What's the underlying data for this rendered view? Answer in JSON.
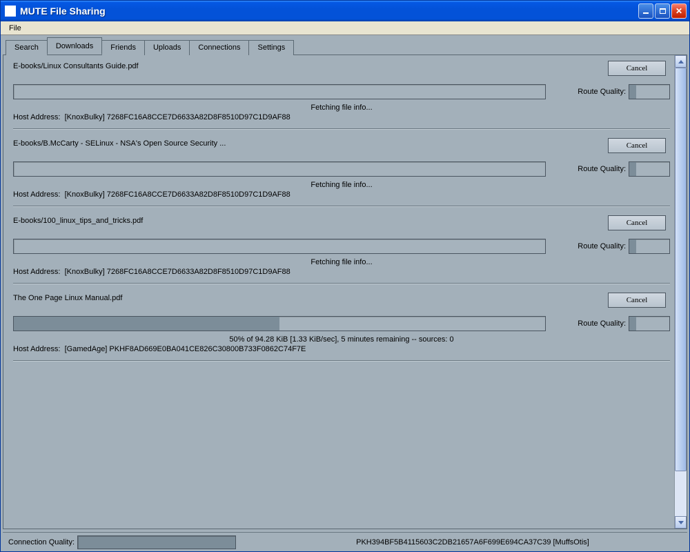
{
  "window": {
    "title": "MUTE File Sharing"
  },
  "menu": {
    "file": "File"
  },
  "tabs": {
    "search": "Search",
    "downloads": "Downloads",
    "friends": "Friends",
    "uploads": "Uploads",
    "connections": "Connections",
    "settings": "Settings"
  },
  "labels": {
    "cancel": "Cancel",
    "route_quality": "Route Quality:",
    "host_address": "Host Address:",
    "connection_quality": "Connection Quality:"
  },
  "downloads": [
    {
      "filename": "E-books/Linux Consultants Guide.pdf",
      "progress_percent": 0,
      "route_quality_percent": 18,
      "status": "Fetching file info...",
      "host": "[KnoxBulky] 7268FC16A8CCE7D6633A82D8F8510D97C1D9AF88"
    },
    {
      "filename": "E-books/B.McCarty - SELinux - NSA's Open Source Security ...",
      "progress_percent": 0,
      "route_quality_percent": 18,
      "status": "Fetching file info...",
      "host": "[KnoxBulky] 7268FC16A8CCE7D6633A82D8F8510D97C1D9AF88"
    },
    {
      "filename": "E-books/100_linux_tips_and_tricks.pdf",
      "progress_percent": 0,
      "route_quality_percent": 18,
      "status": "Fetching file info...",
      "host": "[KnoxBulky] 7268FC16A8CCE7D6633A82D8F8510D97C1D9AF88"
    },
    {
      "filename": "The One Page Linux Manual.pdf",
      "progress_percent": 50,
      "route_quality_percent": 18,
      "status": "50% of 94.28 KiB [1.33 KiB/sec], 5 minutes remaining -- sources: 0",
      "host": "[GamedAge] PKHF8AD669E0BA041CE826C30800B733F0862C74F7E"
    }
  ],
  "statusbar": {
    "node_id": "PKH394BF5B4115603C2DB21657A6F699E694CA37C39 [MuffsOtis]"
  }
}
